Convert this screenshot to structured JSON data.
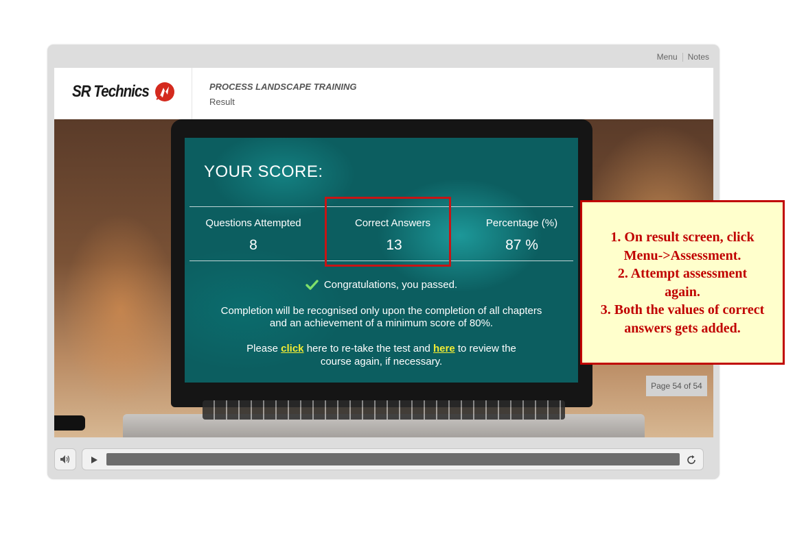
{
  "colors": {
    "brand_red": "#d42a1e",
    "callout_red": "#c00000",
    "callout_bg": "#ffffcc",
    "link_yellow": "#f2ec33",
    "screen_teal": "#0c5e60"
  },
  "topnav": {
    "menu": "Menu",
    "notes": "Notes"
  },
  "header": {
    "logo_text": "SR Technics",
    "logo_icon": "sr-technics-logo-mark",
    "course_title": "PROCESS LANDSCAPE TRAINING",
    "page_name": "Result"
  },
  "score": {
    "title": "YOUR SCORE:",
    "questions_label": "Questions Attempted",
    "questions_value": "8",
    "correct_label": "Correct Answers",
    "correct_value": "13",
    "percentage_label": "Percentage (%)",
    "percentage_value": "87 %",
    "passed_icon": "check-icon",
    "passed_text": "Congratulations, you passed.",
    "completion_line1": "Completion will be recognised only upon the completion of all chapters",
    "completion_line2": "and an achievement of a minimum score of 80%.",
    "retake_pre": "Please ",
    "retake_click": "click",
    "retake_mid": " here to re-take the test and ",
    "retake_here": "here",
    "retake_post": " to review the",
    "retake_line2": "course again, if necessary."
  },
  "page_counter": "Page 54 of 54",
  "controls": {
    "volume_icon": "speaker-icon",
    "play_icon": "play-icon",
    "replay_icon": "replay-icon"
  },
  "callout": {
    "lines": [
      "1. On result screen, click",
      "Menu->Assessment.",
      "2. Attempt assessment",
      "again.",
      "3. Both the values of correct",
      "answers gets added."
    ]
  }
}
